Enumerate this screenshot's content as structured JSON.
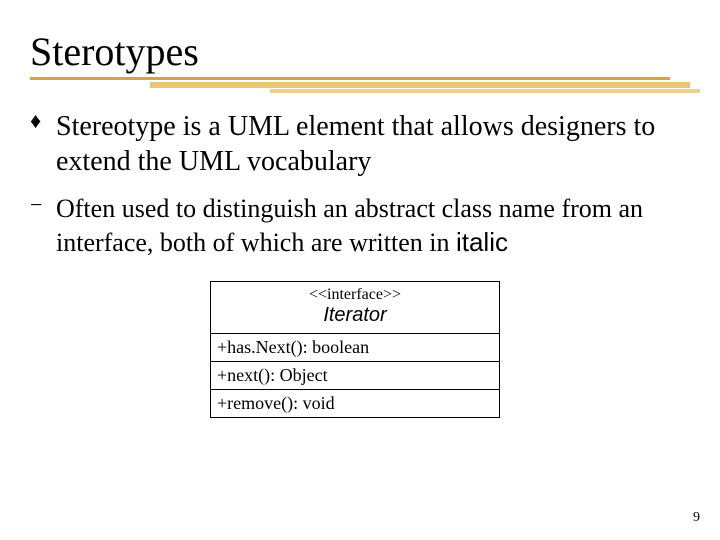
{
  "title": "Sterotypes",
  "bullets": {
    "main": {
      "glyph": "♦",
      "text": "Stereotype is a UML element that allows designers to extend the UML vocabulary"
    },
    "sub": {
      "glyph": "−",
      "text_part1": "Often used to distinguish an abstract class name from an interface, both of which are written in ",
      "text_italic": "italic"
    }
  },
  "uml": {
    "stereotype": "<<interface>>",
    "name": "Iterator",
    "ops": [
      "+has.Next(): boolean",
      "+next(): Object",
      "+remove(): void"
    ]
  },
  "page_number": "9"
}
